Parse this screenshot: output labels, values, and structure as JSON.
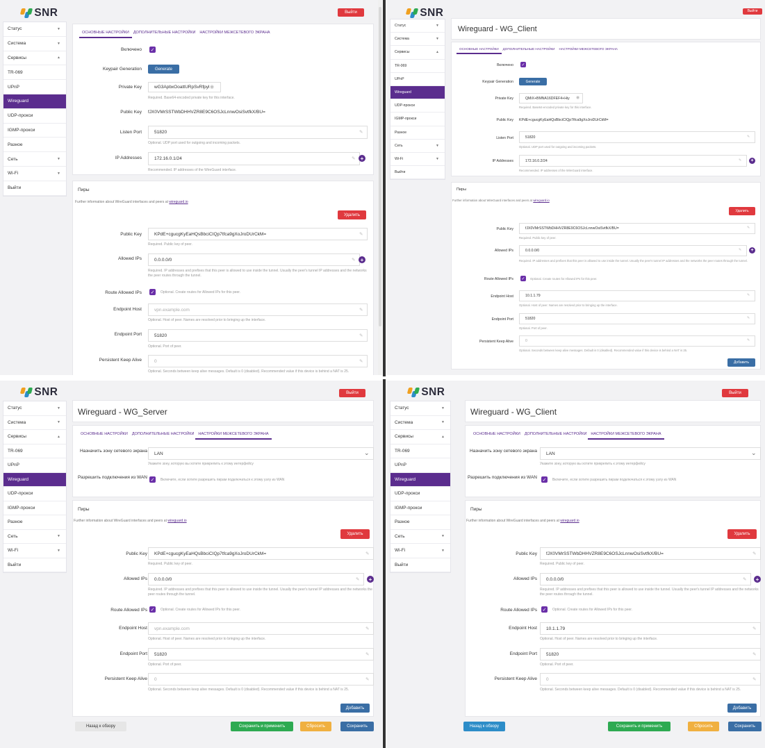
{
  "app": {
    "logo": "SNR",
    "exit_label": "Выйти"
  },
  "sidebar_items": [
    {
      "label": "Статус",
      "arrow": "▼"
    },
    {
      "label": "Система",
      "arrow": "▼"
    },
    {
      "label": "Сервисы",
      "arrow": "▲"
    },
    {
      "label": "TR-069",
      "arrow": ""
    },
    {
      "label": "UPnP",
      "arrow": ""
    },
    {
      "label": "Wireguard",
      "arrow": ""
    },
    {
      "label": "UDP-прокси",
      "arrow": ""
    },
    {
      "label": "IGMP-прокси",
      "arrow": ""
    },
    {
      "label": "Разное",
      "arrow": ""
    },
    {
      "label": "Сеть",
      "arrow": "▼"
    },
    {
      "label": "Wi-Fi",
      "arrow": "▼"
    },
    {
      "label": "Выйти",
      "arrow": ""
    }
  ],
  "tabs": {
    "basic": "ОСНОВНЫЕ НАСТРОЙКИ",
    "extra": "ДОПОЛНИТЕЛЬНЫЕ НАСТРОЙКИ",
    "firewall": "НАСТРОЙКИ МЕЖСЕТЕВОГО ЭКРАНА"
  },
  "labels": {
    "enabled": "Включено",
    "keypair": "Keypair Generation",
    "generate": "Generate",
    "private_key": "Private Key",
    "private_key_help": "Required. Base64-encoded private key for this interface.",
    "public_key": "Public Key",
    "listen_port": "Listen Port",
    "listen_port_help": "Optional. UDP port used for outgoing and incoming packets.",
    "ip_addresses": "IP Addresses",
    "ip_addresses_help": "Recommended. IP addresses of the WireGuard interface.",
    "peers": "Пиры",
    "peers_info": "Further information about WireGuard interfaces and peers at",
    "peers_link": "wireguard.io",
    "delete": "Удалить",
    "peer_public_key_help": "Required. Public key of peer.",
    "allowed_ips": "Allowed IPs",
    "allowed_ips_help": "Required. IP addresses and prefixes that this peer is allowed to use inside the tunnel. Usually the peer's tunnel IP addresses and the networks the peer routes through the tunnel.",
    "route_allowed_ips": "Route Allowed IPs",
    "route_allowed_ips_help": "Optional. Create routes for Allowed IPs for this peer.",
    "endpoint_host": "Endpoint Host",
    "endpoint_host_help": "Optional. Host of peer. Names are resolved prior to bringing up the interface.",
    "endpoint_port": "Endpoint Port",
    "endpoint_port_help": "Optional. Port of peer.",
    "keepalive": "Persistent Keep Alive",
    "keepalive_help": "Optional. Seconds between keep alive messages. Default is 0 (disabled). Recommended value if this device is behind a NAT is 25.",
    "add": "Добавить",
    "zone": "Назначить зону сетевого экрана",
    "zone_help": "Укажите зону, которую вы хотите прикрепить к этому интерфейсу",
    "allow_wan": "Разрешить подключения из WAN",
    "allow_wan_help": "Включите, если хотите разрешить пирам подключаться к этому узлу из WAN",
    "back": "Назад к обзору",
    "save_apply": "Сохранить и применить",
    "reset": "Сбросить",
    "save": "Сохранить",
    "ph_host": "vpn.example.com",
    "ph_keepalive": "0"
  },
  "q1": {
    "private_key": "wG3ApbxOoattURpSvRfpyl",
    "public_key": "fJX0VMrSSTWbDHHVZR8E9C6OSJcLnnwOsiSvtfkX/BU=",
    "listen_port": "51820",
    "ip_addresses": "172.16.0.1/24",
    "peer_public_key": "KPdE+cgucgKyEaHQsBbciCIQp7tfca9gXoJroDUrCkM=",
    "allowed_ips": "0.0.0.0/0",
    "endpoint_port": "51820"
  },
  "q2": {
    "title": "Wireguard - WG_Client",
    "private_key": "QMiX+BMNA16DFEF4+Hiy",
    "public_key": "KPdE+cgucgKyEaHQsBbciCIQp7tfca9gXoJroDUrCkM=",
    "listen_port": "51820",
    "ip_addresses": "172.16.0.2/24",
    "peer_public_key": "fJX0VMrSSTWbDHHVZR8E9C6OSJcLnnwOsiSvtfkX/BU=",
    "allowed_ips": "0.0.0.0/0",
    "endpoint_host": "10.1.1.79",
    "endpoint_port": "51820"
  },
  "q3": {
    "title": "Wireguard - WG_Server",
    "zone": "LAN",
    "peer_public_key": "KPdE+cgucgKyEaHQsBbciCIQp7tfca9gXoJroDUrCkM=",
    "allowed_ips": "0.0.0.0/0",
    "endpoint_port": "51820"
  },
  "q4": {
    "title": "Wireguard - WG_Client",
    "zone": "LAN",
    "peer_public_key": "fJX0VMrSSTWbDHHVZR8E9C6OSJcLnnwOsiSvtfkX/BU=",
    "allowed_ips": "0.0.0.0/0",
    "endpoint_host": "10.1.1.79",
    "endpoint_port": "51820"
  },
  "colors": {
    "accent": "#5b2d8e",
    "danger": "#e0393e",
    "primary": "#3a6ea5",
    "success": "#2eaa52",
    "warning": "#f0b040"
  },
  "icons": [
    "snr-logo-icon",
    "pencil-icon",
    "eye-icon",
    "plus-circle-icon",
    "check-icon",
    "chevron-down-icon"
  ]
}
